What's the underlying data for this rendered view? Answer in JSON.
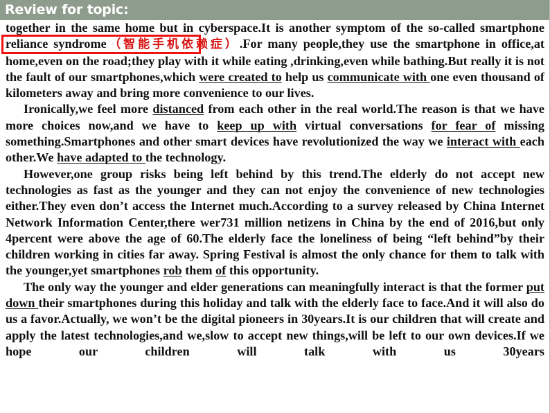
{
  "header": {
    "title": "Review for topic:",
    "background_color": "#8e9c8e",
    "text_color": "#ffffff"
  },
  "annotation": {
    "red_box_color": "#ee1111",
    "red_box_target_text": "smartphone reliance syndrome",
    "chinese_gloss": "（智能手机依赖症）",
    "chinese_gloss_color": "#d81010"
  },
  "passage": {
    "paragraph_1": {
      "pre": "together in the same home but in cyberspace.It is another symptom of the so-called ",
      "boxed": "smartphone reliance syndrome",
      "gloss": "（智能手机依赖症）",
      "after_gloss": ".For many people,they use the smartphone in office,at home,even on the road;they play with it while eating ,drinking,even while bathing.But really it is not the fault of our smartphones,which ",
      "u1": "were created to",
      "mid1": " help us ",
      "u2": "communicate with ",
      "tail": "one even thousand of kilometers away and bring more convenience to our lives."
    },
    "paragraph_2": {
      "s1": "Ironically,we feel more ",
      "u1": "distanced",
      "s2": " from each other in the real world.The reason is that we have more choices now,and we have to ",
      "u2": "keep up with",
      "s3": " virtual conversations ",
      "u3": "for fear of",
      "s4": " missing something.Smartphones and other smart devices have revolutionized the way we ",
      "u4": "interact with ",
      "s5": "each other.We ",
      "u5": "have adapted to ",
      "s6": "the technology."
    },
    "paragraph_3": {
      "s1": "However,one group risks being left behind by this trend.The elderly do not accept new technologies as fast as the younger and they can not enjoy the convenience of new technologies either.They even don’t access the Internet much.According to a survey released by China Internet Network Information Center,there wer731 million netizens in China by the end of 2016,but only 4percent were above the age of 60.The elderly face the loneliness of being “left behind”by their children working in cities far away. Spring Festival is almost the only chance for them to talk with the younger,yet smartphones ",
      "u1": "rob",
      "s2": " them ",
      "u2": "of",
      "s3": " this opportunity."
    },
    "paragraph_4": {
      "s1": "The only way the younger and elder generations can meaningfully interact is that the former ",
      "u1": "put down ",
      "s2": "their smartphones during this holiday and talk with the elderly face to face.And it will also do us a favor.Actually, we won’t be  the digital pioneers in 30years.It is our children that will create and apply the latest technologies,and we,slow to accept new things,will be left to our own devices.If we hope our children will talk with us 30years"
    }
  }
}
